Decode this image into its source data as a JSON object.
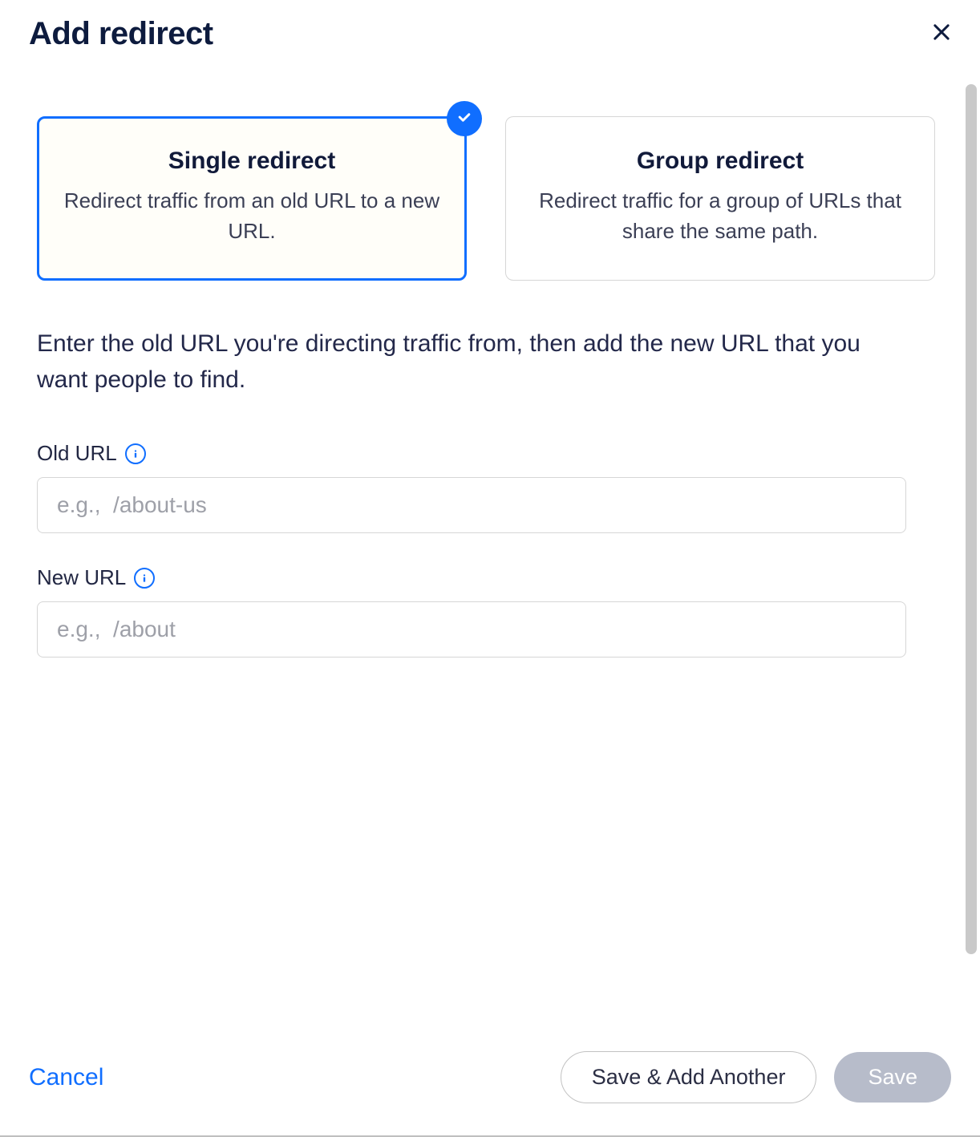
{
  "modal": {
    "title": "Add redirect"
  },
  "options": {
    "single": {
      "title": "Single redirect",
      "description": "Redirect traffic from an old URL to a new URL."
    },
    "group": {
      "title": "Group redirect",
      "description": "Redirect traffic for a group of URLs that share the same path."
    }
  },
  "instruction": "Enter the old URL you're directing traffic from, then add the new URL that you want people to find.",
  "fields": {
    "old_url": {
      "label": "Old URL",
      "placeholder": "e.g.,  /about-us",
      "value": ""
    },
    "new_url": {
      "label": "New URL",
      "placeholder": "e.g.,  /about",
      "value": ""
    }
  },
  "footer": {
    "cancel": "Cancel",
    "save_add_another": "Save & Add Another",
    "save": "Save"
  }
}
